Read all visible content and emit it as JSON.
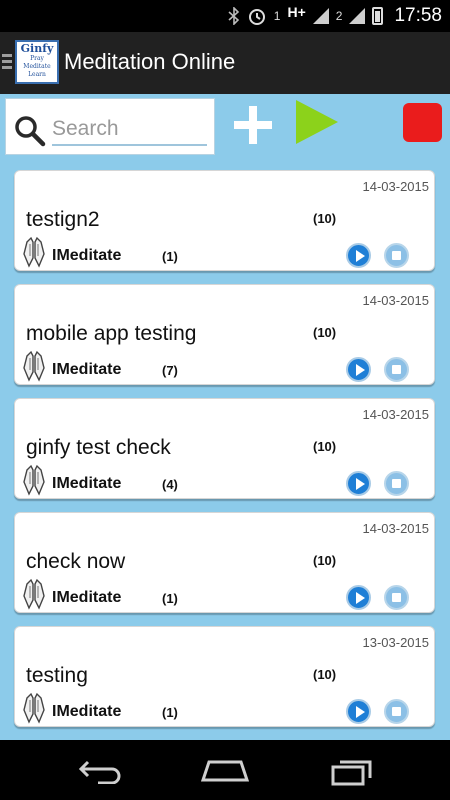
{
  "status_bar": {
    "time": "17:58",
    "sim1": "1",
    "network": "H+",
    "sim2": "2"
  },
  "header": {
    "logo_line1": "Ginfy",
    "logo_line2": "Pray",
    "logo_line3": "Meditate",
    "logo_line4": "Learn",
    "title": "Meditation Online"
  },
  "toolbar": {
    "search_placeholder": "Search"
  },
  "colors": {
    "background": "#8ccbea",
    "play_accent": "#8cd21b",
    "stop_accent": "#ea1c1c",
    "card_play": "#1f7fd6"
  },
  "sessions": [
    {
      "date": "14-03-2015",
      "title": "testign2",
      "count": "(10)",
      "author": "IMeditate",
      "meditators": "(1)"
    },
    {
      "date": "14-03-2015",
      "title": "mobile app testing",
      "count": "(10)",
      "author": "IMeditate",
      "meditators": "(7)"
    },
    {
      "date": "14-03-2015",
      "title": "ginfy test check",
      "count": "(10)",
      "author": "IMeditate",
      "meditators": "(4)"
    },
    {
      "date": "14-03-2015",
      "title": "check now",
      "count": "(10)",
      "author": "IMeditate",
      "meditators": "(1)"
    },
    {
      "date": "13-03-2015",
      "title": "testing",
      "count": "(10)",
      "author": "IMeditate",
      "meditators": "(1)"
    }
  ]
}
